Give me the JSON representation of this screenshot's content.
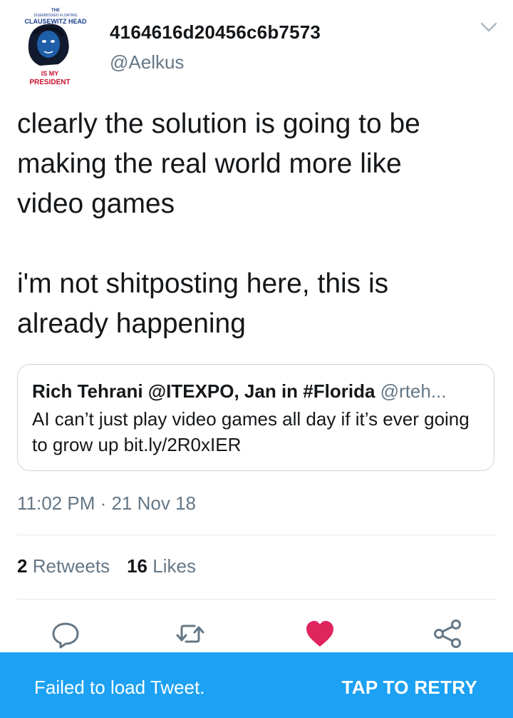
{
  "author": {
    "display_name": "4164616d20456c6b7573",
    "handle": "@Aelkus",
    "avatar": {
      "top_small": "THE",
      "top_line": "DISEMBODIED FLOATING",
      "top_name": "CLAUSEWITZ HEAD",
      "bottom_line1": "IS MY",
      "bottom_line2": "PRESIDENT"
    }
  },
  "tweet": {
    "text": "clearly the solution is going to be\nmaking the real world more like\nvideo games\n\ni'm not shitposting here, this is\nalready happening",
    "timestamp": "11:02 PM · 21 Nov 18"
  },
  "quote": {
    "name": "Rich Tehrani @ITEXPO, Jan in #Florida",
    "handle": "@rteh...",
    "text": "AI can’t just play video games all day if it’s ever going to grow up bit.ly/2R0xIER"
  },
  "stats": {
    "retweets_count": "2",
    "retweets_label": "Retweets",
    "likes_count": "16",
    "likes_label": "Likes"
  },
  "actions": {
    "reply_icon": "reply-icon",
    "retweet_icon": "retweet-icon",
    "like_icon": "heart-icon",
    "share_icon": "share-icon",
    "liked": true
  },
  "snackbar": {
    "message": "Failed to load Tweet.",
    "action": "TAP TO RETRY"
  },
  "colors": {
    "accent": "#1da1f2",
    "like": "#e0245e",
    "secondary_text": "#657786"
  }
}
